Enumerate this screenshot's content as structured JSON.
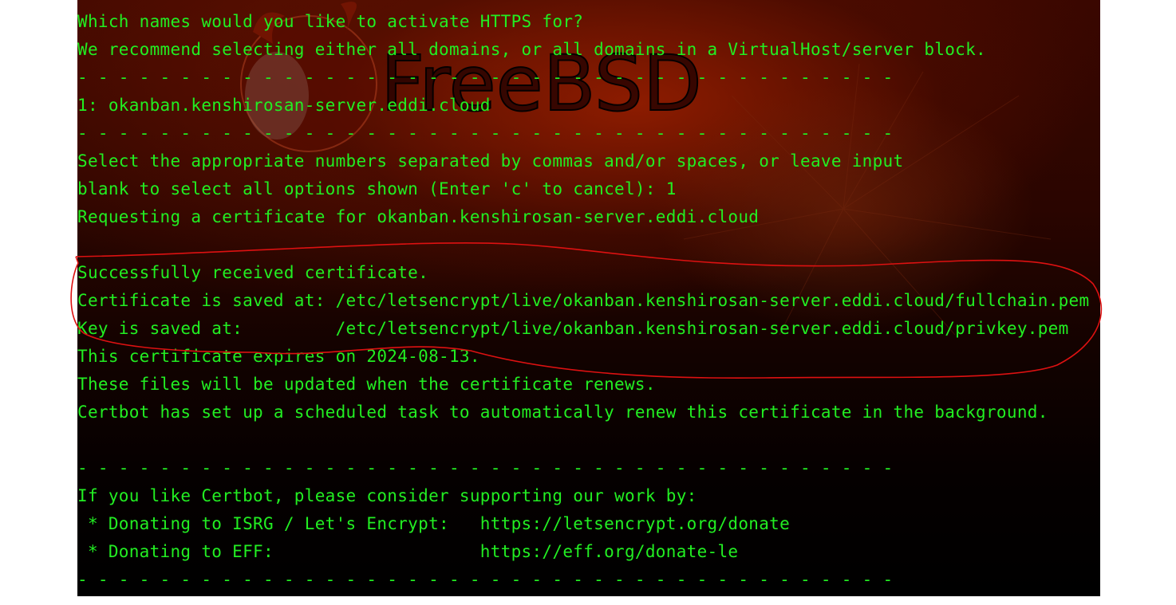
{
  "wallpaper": {
    "logo_text": "FreeBSD",
    "background_colors": [
      "#3a0700",
      "#960f00",
      "#000000"
    ]
  },
  "terminal": {
    "text_color": "#22ee22",
    "lines": [
      "Which names would you like to activate HTTPS for?",
      "We recommend selecting either all domains, or all domains in a VirtualHost/server block.",
      "- - - - - - - - - - - - - - - - - - - - - - - - - - - - - - - - - - - - - - - -",
      "1: okanban.kenshirosan-server.eddi.cloud",
      "- - - - - - - - - - - - - - - - - - - - - - - - - - - - - - - - - - - - - - - -",
      "Select the appropriate numbers separated by commas and/or spaces, or leave input",
      "blank to select all options shown (Enter 'c' to cancel): 1",
      "Requesting a certificate for okanban.kenshirosan-server.eddi.cloud",
      "",
      "Successfully received certificate.",
      "Certificate is saved at: /etc/letsencrypt/live/okanban.kenshirosan-server.eddi.cloud/fullchain.pem",
      "Key is saved at:         /etc/letsencrypt/live/okanban.kenshirosan-server.eddi.cloud/privkey.pem",
      "This certificate expires on 2024-08-13.",
      "These files will be updated when the certificate renews.",
      "Certbot has set up a scheduled task to automatically renew this certificate in the background.",
      "",
      "- - - - - - - - - - - - - - - - - - - - - - - - - - - - - - - - - - - - - - - -",
      "If you like Certbot, please consider supporting our work by:",
      " * Donating to ISRG / Let's Encrypt:   https://letsencrypt.org/donate",
      " * Donating to EFF:                    https://eff.org/donate-le",
      "- - - - - - - - - - - - - - - - - - - - - - - - - - - - - - - - - - - - - - - -"
    ]
  },
  "annotation": {
    "color": "#dd1111",
    "shape": "hand-drawn circle around certificate save paths"
  }
}
